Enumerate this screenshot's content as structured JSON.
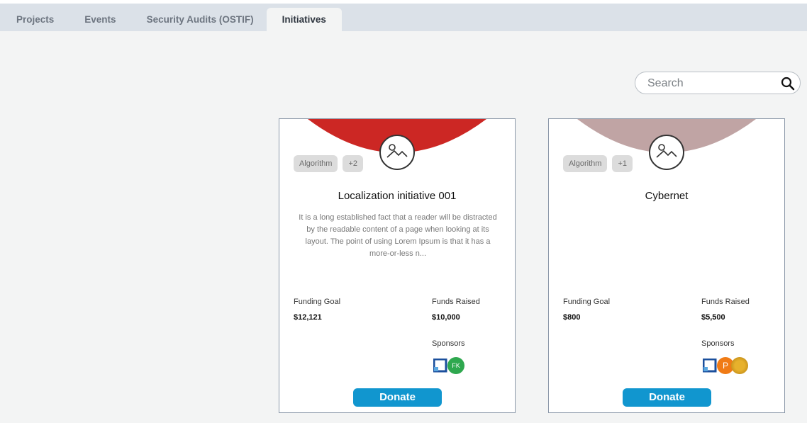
{
  "tabs": [
    {
      "label": "Projects"
    },
    {
      "label": "Events"
    },
    {
      "label": "Security Audits (OSTIF)"
    },
    {
      "label": "Initiatives"
    }
  ],
  "active_tab": "Initiatives",
  "search": {
    "placeholder": "Search",
    "value": "",
    "icon": "search-icon"
  },
  "colors": {
    "tab_bar": "#dbe1e8",
    "donate": "#1196cf",
    "card1_banner": "#cc2724",
    "card2_banner": "#c0a4a4"
  },
  "cards": [
    {
      "banner_color": "#cc2724",
      "tags": [
        "Algorithm",
        "+2"
      ],
      "title": "Localization initiative 001",
      "description": "It is a long established fact that a reader will be distracted by the readable content of a page when looking at its layout. The point of using Lorem Ipsum is that it has a more-or-less n...",
      "funding_goal_label": "Funding Goal",
      "funding_goal": "$12,121",
      "funds_raised_label": "Funds Raised",
      "funds_raised": "$10,000",
      "sponsors_label": "Sponsors",
      "sponsors": [
        "square-logo",
        "FK"
      ],
      "donate_label": "Donate"
    },
    {
      "banner_color": "#c0a4a4",
      "tags": [
        "Algorithm",
        "+1"
      ],
      "title": "Cybernet",
      "description": "",
      "funding_goal_label": "Funding Goal",
      "funding_goal": "$800",
      "funds_raised_label": "Funds Raised",
      "funds_raised": "$5,500",
      "sponsors_label": "Sponsors",
      "sponsors": [
        "square-logo",
        "P",
        "gold-seal"
      ],
      "donate_label": "Donate"
    }
  ]
}
